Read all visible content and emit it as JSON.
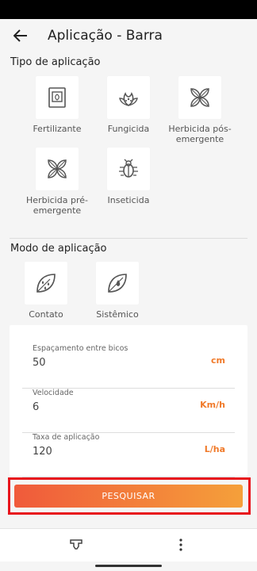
{
  "header": {
    "title": "Aplicação - Barra",
    "back_icon": "arrow-back-icon"
  },
  "sections": {
    "tipo_title": "Tipo de aplicação",
    "modo_title": "Modo de aplicação"
  },
  "tipos": [
    {
      "label": "Fertilizante",
      "icon": "fertilizer-icon"
    },
    {
      "label": "Fungicida",
      "icon": "fungicide-icon"
    },
    {
      "label": "Herbicida pós-emergente",
      "icon": "herbicide-post-icon"
    },
    {
      "label": "Herbicida pré-emergente",
      "icon": "herbicide-pre-icon"
    },
    {
      "label": "Inseticida",
      "icon": "insecticide-icon"
    }
  ],
  "modos": [
    {
      "label": "Contato",
      "icon": "contact-leaf-icon"
    },
    {
      "label": "Sistêmico",
      "icon": "systemic-leaf-icon"
    }
  ],
  "fields": [
    {
      "label": "Espaçamento entre bicos",
      "value": "50",
      "unit": "cm"
    },
    {
      "label": "Velocidade",
      "value": "6",
      "unit": "Km/h"
    },
    {
      "label": "Taxa de aplicação",
      "value": "120",
      "unit": "L/ha"
    }
  ],
  "search_button": "PESQUISAR",
  "bottom_nav": {
    "left_icon": "nozzle-icon",
    "right_icon": "more-vert-icon"
  },
  "colors": {
    "accent": "#f07a2a",
    "button_start": "#f05a3b",
    "button_end": "#f5a03a",
    "highlight": "#e8141c"
  }
}
